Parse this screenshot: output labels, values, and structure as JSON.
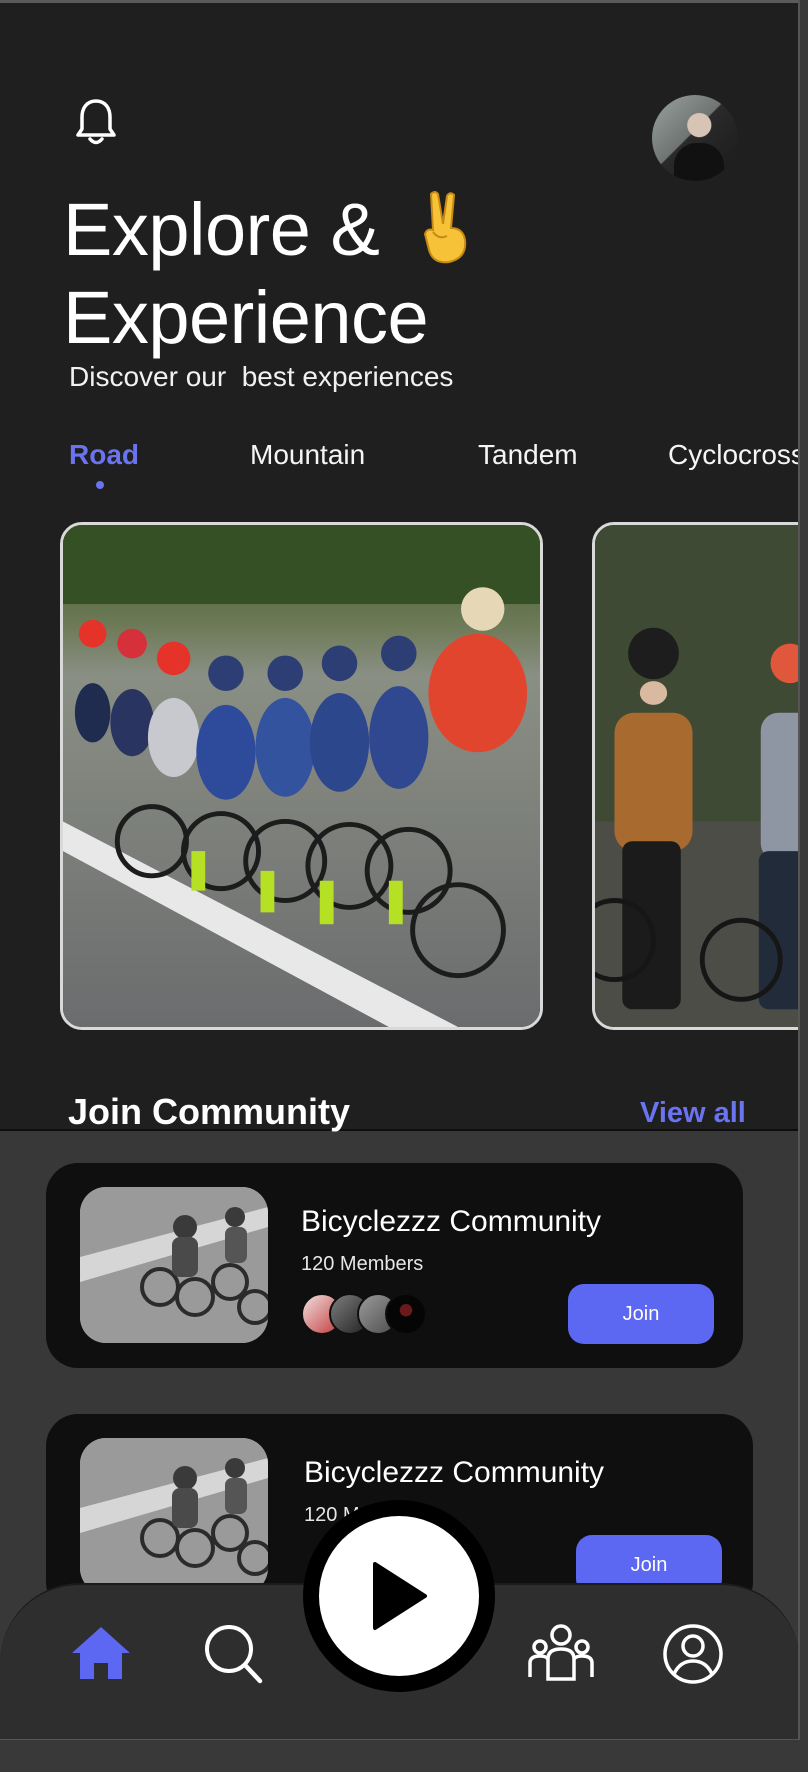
{
  "header": {
    "headline_line1": "Explore &",
    "headline_line2": "Experience",
    "emoji": "✌️",
    "subtitle": "Discover our  best experiences",
    "icons": {
      "notification": "bell-icon",
      "profile": "avatar"
    }
  },
  "tabs": [
    {
      "label": "Road",
      "active": true
    },
    {
      "label": "Mountain",
      "active": false
    },
    {
      "label": "Tandem",
      "active": false
    },
    {
      "label": "Cyclocross",
      "active": false
    }
  ],
  "featured": [
    {
      "image": "road-cycling-peloton-photo"
    },
    {
      "image": "mountain-cyclists-photo"
    }
  ],
  "community": {
    "title": "Join Community",
    "view_all": "View all",
    "cards": [
      {
        "name": "Bicyclezzz Community",
        "members": "120 Members",
        "join_label": "Join"
      },
      {
        "name": "Bicyclezzz Community",
        "members": "120 Members",
        "join_label": "Join"
      }
    ]
  },
  "nav": {
    "items": [
      "home-icon",
      "search-icon",
      "play-icon",
      "community-icon",
      "profile-icon"
    ],
    "active": "home-icon"
  },
  "colors": {
    "accent": "#5c67f2",
    "background": "#1f1f1f",
    "card": "#0f0f0f"
  }
}
